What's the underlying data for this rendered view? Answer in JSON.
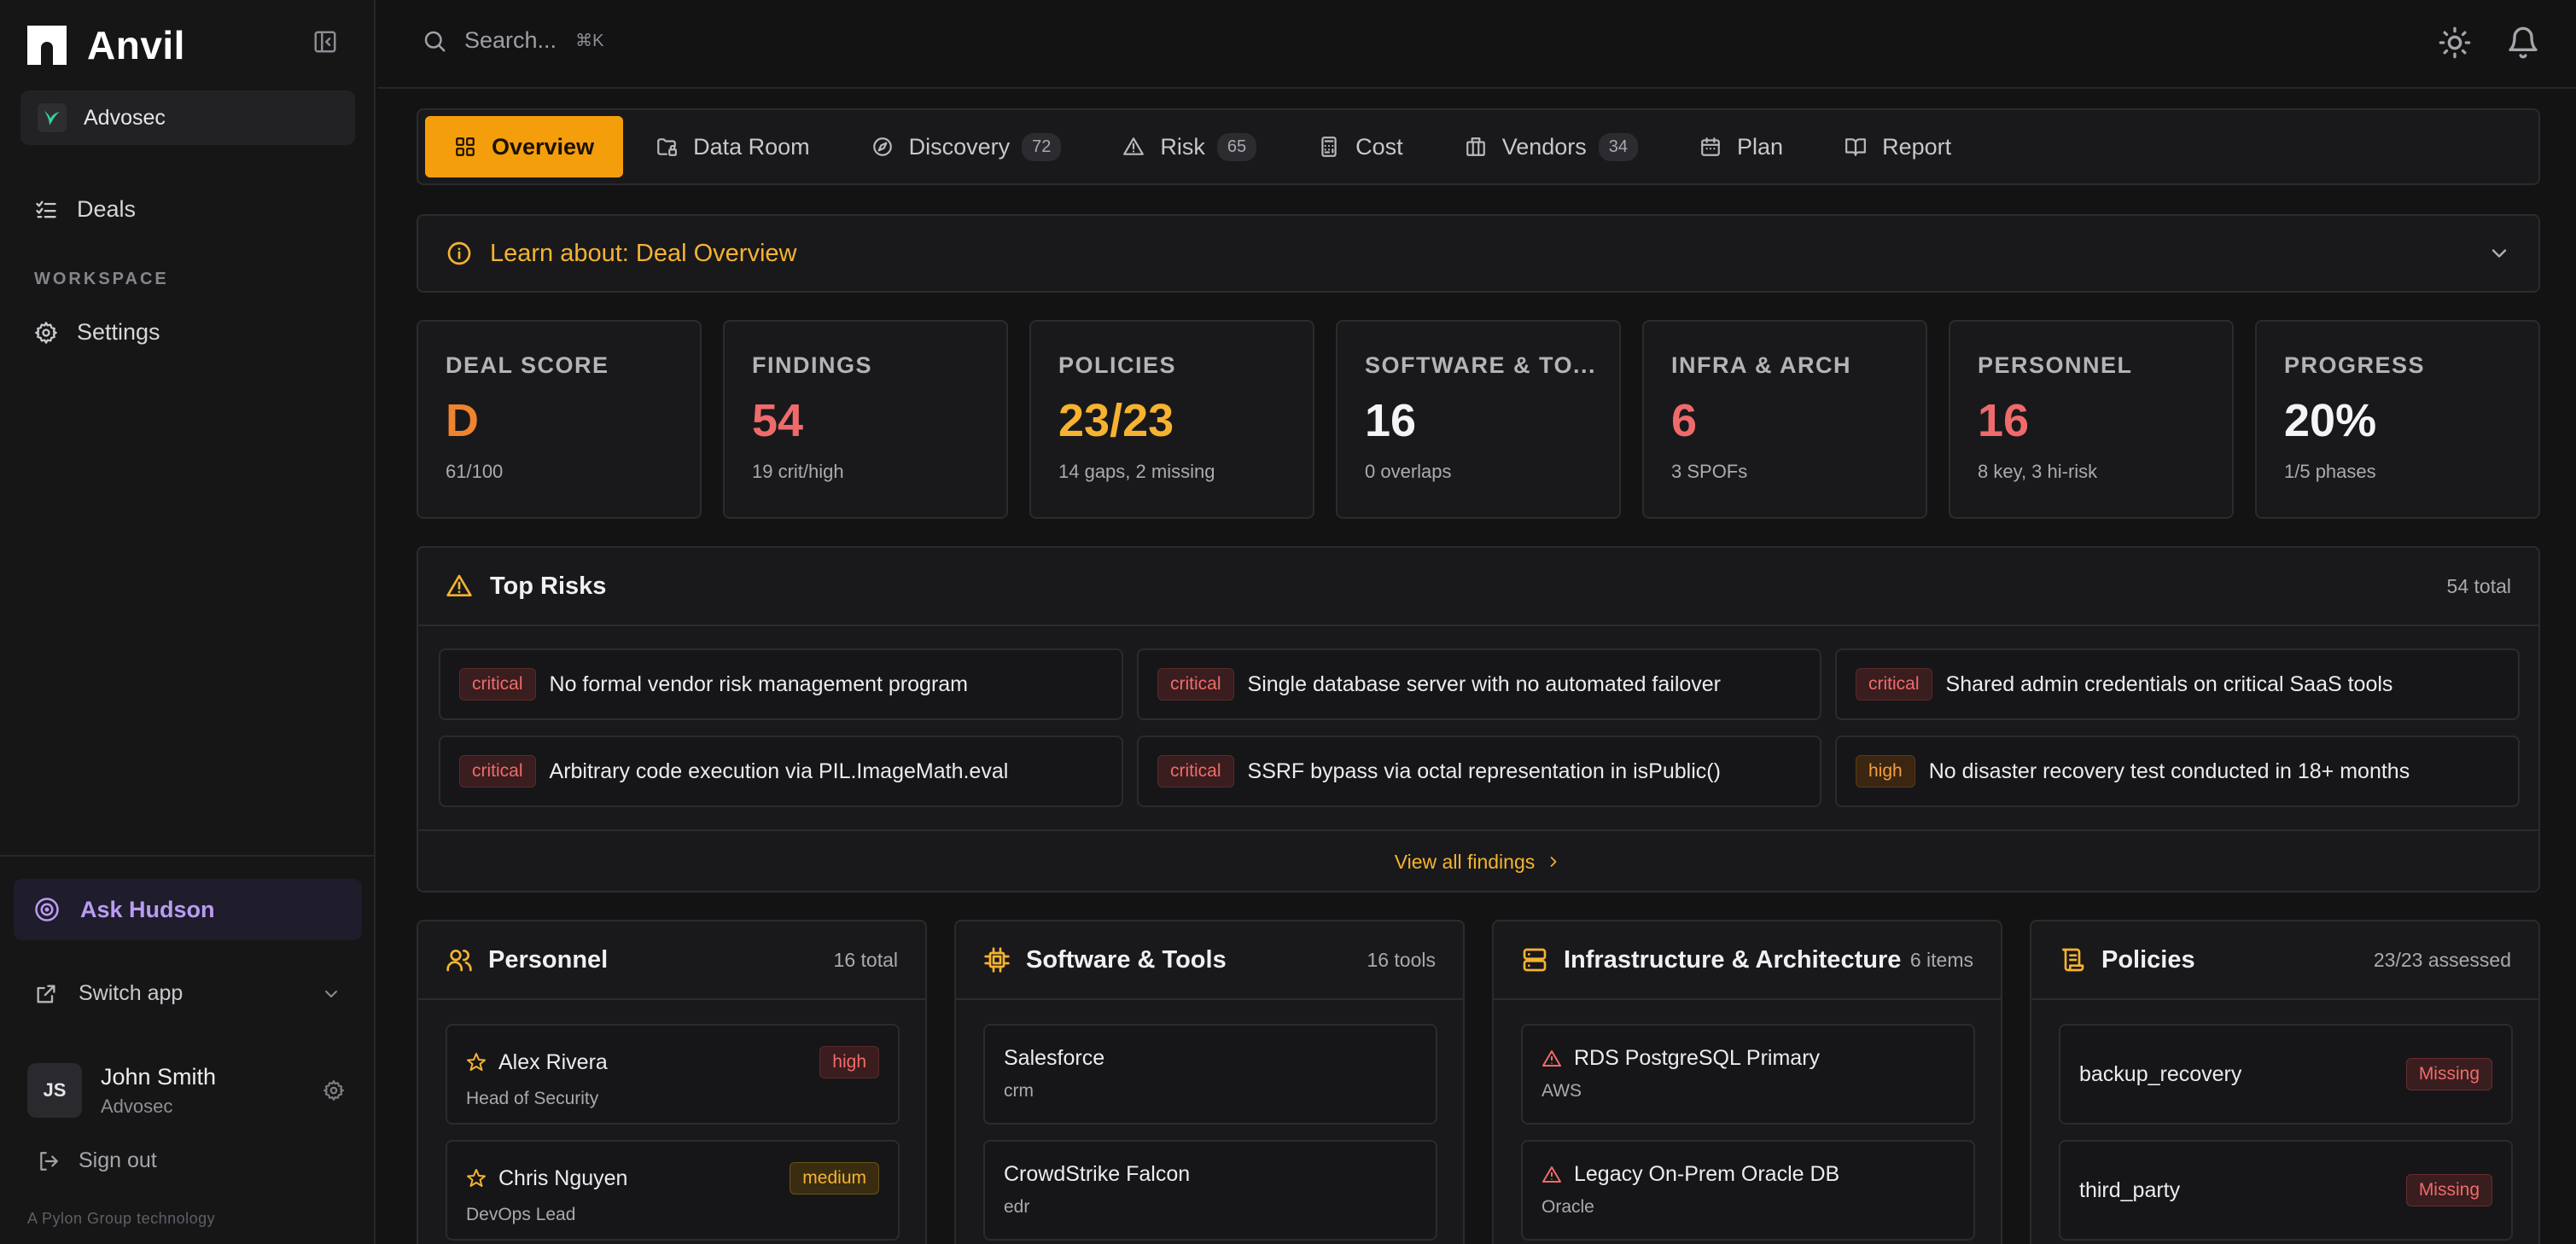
{
  "app": {
    "name": "Anvil",
    "org": "Advosec"
  },
  "sidebar": {
    "deals_label": "Deals",
    "section_label": "WORKSPACE",
    "settings_label": "Settings",
    "ask_label": "Ask Hudson",
    "switch_label": "Switch app",
    "user": {
      "initials": "JS",
      "name": "John Smith",
      "org": "Advosec"
    },
    "signout_label": "Sign out",
    "footnote": "A Pylon Group technology"
  },
  "topbar": {
    "search_placeholder": "Search...",
    "shortcut": "⌘K"
  },
  "tabs": [
    {
      "label": "Overview",
      "count": ""
    },
    {
      "label": "Data Room",
      "count": ""
    },
    {
      "label": "Discovery",
      "count": "72"
    },
    {
      "label": "Risk",
      "count": "65"
    },
    {
      "label": "Cost",
      "count": ""
    },
    {
      "label": "Vendors",
      "count": "34"
    },
    {
      "label": "Plan",
      "count": ""
    },
    {
      "label": "Report",
      "count": ""
    }
  ],
  "learn": {
    "label": "Learn about: Deal Overview"
  },
  "stats": [
    {
      "title": "DEAL SCORE",
      "value": "D",
      "sub": "61/100",
      "color": "#f0832e"
    },
    {
      "title": "FINDINGS",
      "value": "54",
      "sub": "19 crit/high",
      "color": "#ef6b6b"
    },
    {
      "title": "POLICIES",
      "value": "23/23",
      "sub": "14 gaps, 2 missing",
      "color": "#f5b331"
    },
    {
      "title": "SOFTWARE & TO...",
      "value": "16",
      "sub": "0 overlaps",
      "color": "#f4f4f6"
    },
    {
      "title": "INFRA & ARCH",
      "value": "6",
      "sub": "3 SPOFs",
      "color": "#ef6b6b"
    },
    {
      "title": "PERSONNEL",
      "value": "16",
      "sub": "8 key, 3 hi-risk",
      "color": "#ef6b6b"
    },
    {
      "title": "PROGRESS",
      "value": "20%",
      "sub": "1/5 phases",
      "color": "#f4f4f6"
    }
  ],
  "risks": {
    "title": "Top Risks",
    "total": "54 total",
    "items": [
      {
        "severity": "critical",
        "text": "No formal vendor risk management program"
      },
      {
        "severity": "critical",
        "text": "Single database server with no automated failover"
      },
      {
        "severity": "critical",
        "text": "Shared admin credentials on critical SaaS tools"
      },
      {
        "severity": "critical",
        "text": "Arbitrary code execution via PIL.ImageMath.eval"
      },
      {
        "severity": "critical",
        "text": "SSRF bypass via octal representation in isPublic()"
      },
      {
        "severity": "high",
        "text": "No disaster recovery test conducted in 18+ months"
      }
    ],
    "view_all": "View all findings"
  },
  "panels": {
    "personnel": {
      "title": "Personnel",
      "meta": "16 total",
      "items": [
        {
          "name": "Alex Rivera",
          "role": "Head of Security",
          "badge": "high"
        },
        {
          "name": "Chris Nguyen",
          "role": "DevOps Lead",
          "badge": "medium"
        }
      ]
    },
    "software": {
      "title": "Software & Tools",
      "meta": "16 tools",
      "items": [
        {
          "name": "Salesforce",
          "sub": "crm"
        },
        {
          "name": "CrowdStrike Falcon",
          "sub": "edr"
        }
      ]
    },
    "infra": {
      "title": "Infrastructure & Architecture",
      "meta": "6 items",
      "items": [
        {
          "name": "RDS PostgreSQL Primary",
          "sub": "AWS"
        },
        {
          "name": "Legacy On-Prem Oracle DB",
          "sub": "Oracle"
        }
      ]
    },
    "policies": {
      "title": "Policies",
      "meta": "23/23 assessed",
      "items": [
        {
          "name": "backup_recovery",
          "badge": "Missing"
        },
        {
          "name": "third_party",
          "badge": "Missing"
        }
      ]
    }
  }
}
